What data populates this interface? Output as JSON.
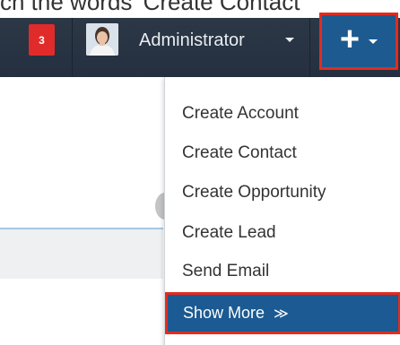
{
  "topbar": {
    "cropped_text": "ch the words 'Create Contact'"
  },
  "navbar": {
    "notification_count": "3",
    "username": "Administrator",
    "quick_create_symbol": "+"
  },
  "quick_create_menu": {
    "items": [
      "Create Account",
      "Create Contact",
      "Create Opportunity",
      "Create Lead",
      "Send Email"
    ],
    "show_more_label": "Show More",
    "show_more_icon": "≫"
  },
  "colors": {
    "navbar_bg": "#2b3744",
    "badge_red": "#e12b2b",
    "highlight_border": "#e32b1f",
    "active_blue": "#1b5a92"
  },
  "icons": [
    "user-avatar",
    "plus-icon",
    "chevron-down-icon",
    "double-chevron-down-icon"
  ]
}
